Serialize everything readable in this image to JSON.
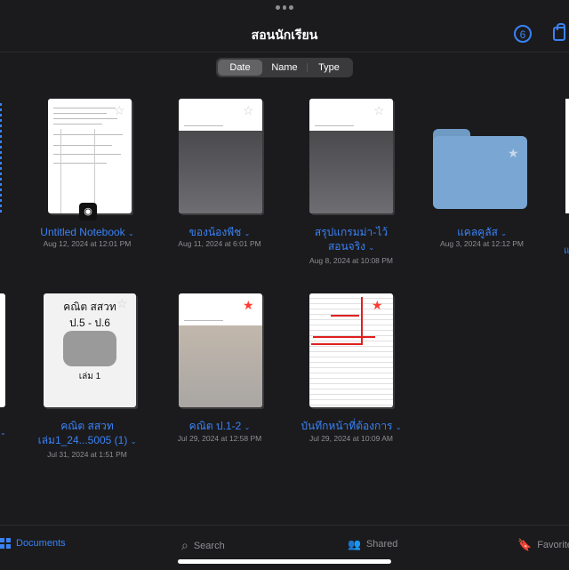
{
  "header": {
    "title": "สอนนักเรียน",
    "badge": "6"
  },
  "sort": {
    "options": [
      "Date",
      "Name",
      "Type"
    ],
    "selected": "Date"
  },
  "items": [
    {
      "name": "Untitled Notebook",
      "date": "Aug 12, 2024 at 12:01 PM",
      "starred": false
    },
    {
      "name": "ของน้องพีช",
      "date": "Aug 11, 2024 at 6:01 PM",
      "starred": false
    },
    {
      "name1": "สรุปแกรมม่า-ไว้",
      "name2": "สอนจริง",
      "date": "Aug 8, 2024 at 10:08 PM",
      "starred": false
    },
    {
      "name": "แคลคูลัส",
      "date": "Aug 3, 2024 at 12:12 PM",
      "starred": false
    },
    {
      "name1": "คณิต สสวท",
      "name2": "เล่ม1_24...5005 (1)",
      "date": "Jul 31, 2024 at 1:51 PM",
      "starred": false,
      "cover_lines": [
        "คณิต สสวท",
        "ป.5 - ป.6",
        "เล่ม 1"
      ]
    },
    {
      "name": "คณิต ป.1-2",
      "date": "Jul 29, 2024 at 12:58 PM",
      "starred": true
    },
    {
      "name": "บันทึกหน้าที่ต้องการ",
      "date": "Jul 29, 2024 at 10:09 AM",
      "starred": true
    }
  ],
  "tabs": {
    "documents": "Documents",
    "search": "Search",
    "shared": "Shared",
    "favorites": "Favorites"
  },
  "colors": {
    "accent": "#3a82f7",
    "background": "#1b1b1d",
    "star_red": "#ff3b30",
    "folder": "#7aa6d3"
  }
}
